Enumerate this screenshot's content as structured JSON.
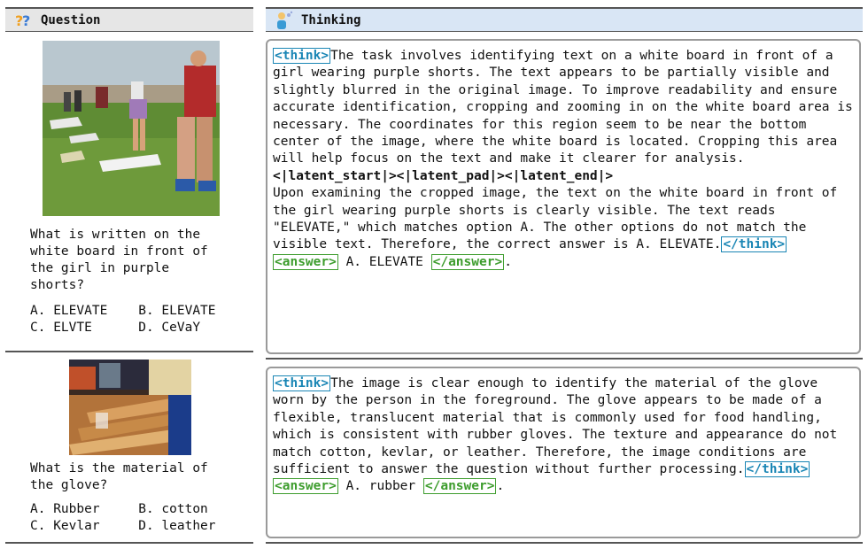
{
  "header": {
    "question_label": "Question",
    "thinking_label": "Thinking"
  },
  "examples": [
    {
      "question": "What is written on the\nwhite board in front of\nthe girl in purple\nshorts?",
      "options": "A. ELEVATE    B. ELEVATE\nC. ELVTE      D. CeVaY",
      "think_open": "<think>",
      "think_text_1": "The task involves identifying text on a white board in front of a girl wearing purple shorts. The text appears to be partially visible and slightly blurred in the original image. To improve readability and ensure accurate identification, cropping and zooming in on the white board area is necessary. The coordinates for this region seem to be near the bottom center of the image, where the white board is located. Cropping this area will help focus on the text and make it clearer for analysis.",
      "latent": "<|latent_start|><|latent_pad|><|latent_end|>",
      "think_text_2": "Upon examining the cropped image, the text on the white board in front of the girl wearing purple shorts is clearly visible. The text reads \"ELEVATE,\" which matches option A. The other options do not match the visible text. Therefore, the correct answer is A. ELEVATE.",
      "think_close": "</think>",
      "answer_open": "<answer>",
      "answer_text": " A. ELEVATE ",
      "answer_close": "</answer>",
      "trailing": "."
    },
    {
      "question": "What is the material of\nthe glove?",
      "options": "A. Rubber     B. cotton\nC. Kevlar     D. leather",
      "think_open": "<think>",
      "think_text_1": "The image is clear enough to identify the material of the glove worn by the person in the foreground. The glove appears to be made of a flexible, translucent material that is commonly used for food handling, which is consistent with rubber gloves. The texture and appearance do not match cotton, kevlar, or leather. Therefore, the image conditions are sufficient to answer the question without further processing.",
      "think_close": "</think>",
      "answer_open": "<answer>",
      "answer_text": " A. rubber ",
      "answer_close": "</answer>",
      "trailing": "."
    }
  ]
}
